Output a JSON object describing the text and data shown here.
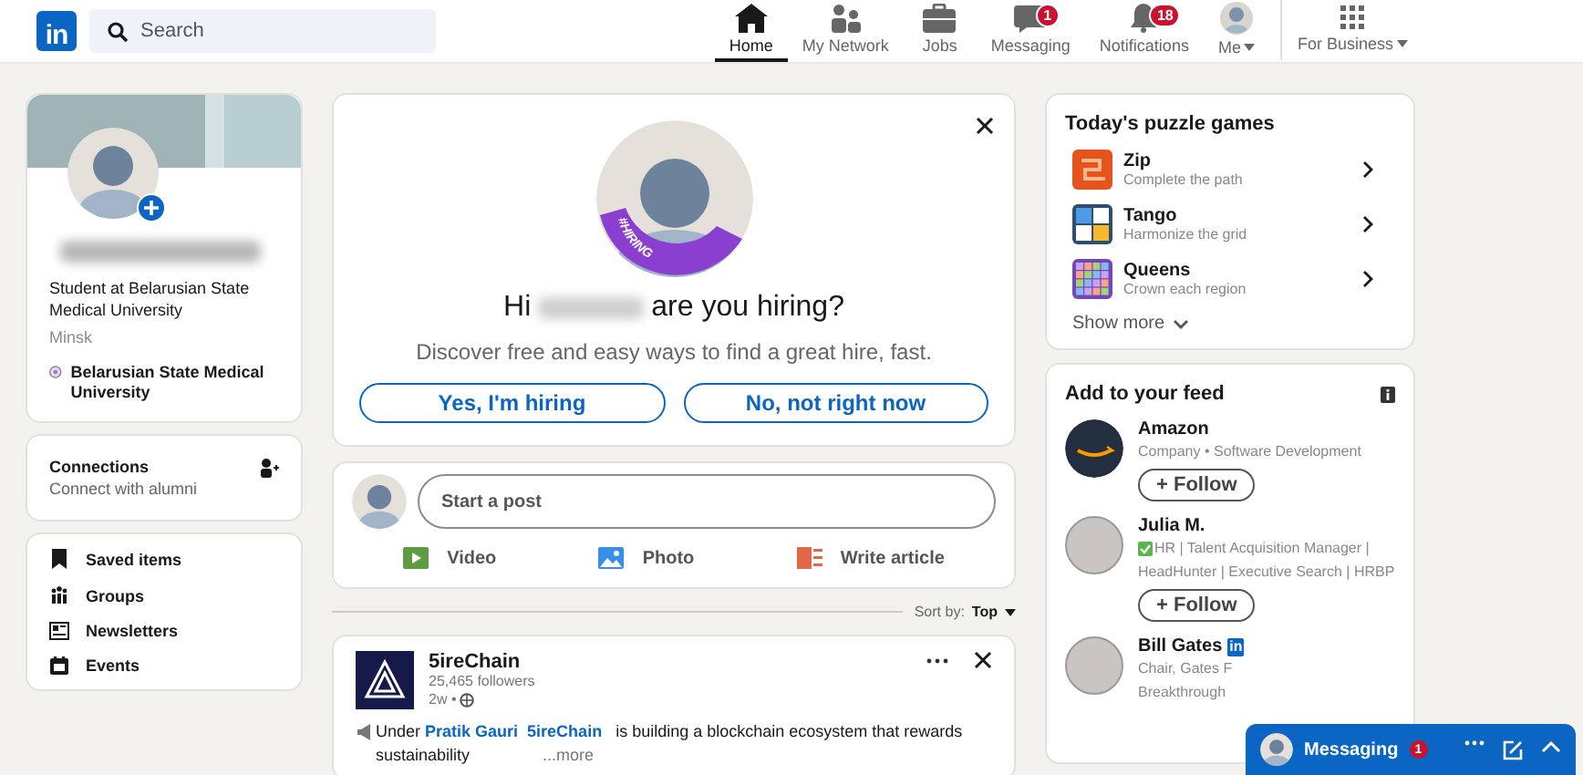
{
  "nav": {
    "logo": "in",
    "search": {
      "placeholder": "Search"
    },
    "items": [
      {
        "label": "Home",
        "kind": "home",
        "selected": true
      },
      {
        "label": "My Network",
        "kind": "network",
        "selected": false
      },
      {
        "label": "Jobs",
        "kind": "jobs",
        "selected": false
      },
      {
        "label": "Messaging",
        "kind": "messaging",
        "badge": "1",
        "selected": false
      },
      {
        "label": "Notifications",
        "kind": "bell",
        "badge": "18",
        "selected": false
      },
      {
        "label": "Me",
        "kind": "me",
        "selected": false
      }
    ],
    "business": "For Business"
  },
  "profile": {
    "headline": "Student at Belarusian State Medical University",
    "location": "Minsk",
    "school": "Belarusian State Medical University"
  },
  "connections": {
    "title": "Connections",
    "subtitle": "Connect with alumni"
  },
  "shortcuts": [
    {
      "label": "Saved items",
      "kind": "bookmark"
    },
    {
      "label": "Groups",
      "kind": "groups"
    },
    {
      "label": "Newsletters",
      "kind": "newsletter"
    },
    {
      "label": "Events",
      "kind": "calendar"
    }
  ],
  "hiring": {
    "badge": "#HIRING",
    "greeting": "Hi",
    "question": "are you hiring?",
    "subtitle": "Discover free and easy ways to find a great hire, fast.",
    "buttons": [
      "Yes, I'm hiring",
      "No, not right now"
    ]
  },
  "composer": {
    "placeholder": "Start a post",
    "actions": [
      {
        "label": "Video",
        "kind": "video"
      },
      {
        "label": "Photo",
        "kind": "photo"
      },
      {
        "label": "Write article",
        "kind": "article"
      }
    ]
  },
  "sort": {
    "label": "Sort by:",
    "value": "Top"
  },
  "post": {
    "author": "5ireChain",
    "followers": "25,465 followers",
    "time": "2w •",
    "body": [
      {
        "kind": "text",
        "text": "Under "
      },
      {
        "kind": "link",
        "text": "Pratik Gauri"
      },
      {
        "kind": "link",
        "text": "5ireChain"
      },
      {
        "kind": "text",
        "text": " is building a blockchain ecosystem that rewards sustainability"
      }
    ],
    "more": "...more"
  },
  "puzzles": {
    "title": "Today's puzzle games",
    "games": [
      {
        "name": "Zip",
        "subtitle": "Complete the path",
        "kind": "zip"
      },
      {
        "name": "Tango",
        "subtitle": "Harmonize the grid",
        "kind": "tango"
      },
      {
        "name": "Queens",
        "subtitle": "Crown each region",
        "kind": "queens"
      }
    ],
    "show_more": "Show more"
  },
  "feed": {
    "title": "Add to your feed",
    "items": [
      {
        "name": "Amazon",
        "kind": "company",
        "verified": false,
        "lines": [
          "Company • Software Development"
        ],
        "follow": "+ Follow"
      },
      {
        "name": "Julia M.",
        "kind": "person",
        "verified": true,
        "lines": [
          "HR | Talent Acquisition Manager |",
          "HeadHunter | Executive Search | HRBP"
        ],
        "follow": "+ Follow"
      },
      {
        "name": "Bill Gates",
        "kind": "person",
        "verified": false,
        "badge": "in",
        "lines": [
          "Chair, Gates F",
          "Breakthrough"
        ]
      }
    ]
  },
  "messaging": {
    "label": "Messaging",
    "badge": "1"
  }
}
